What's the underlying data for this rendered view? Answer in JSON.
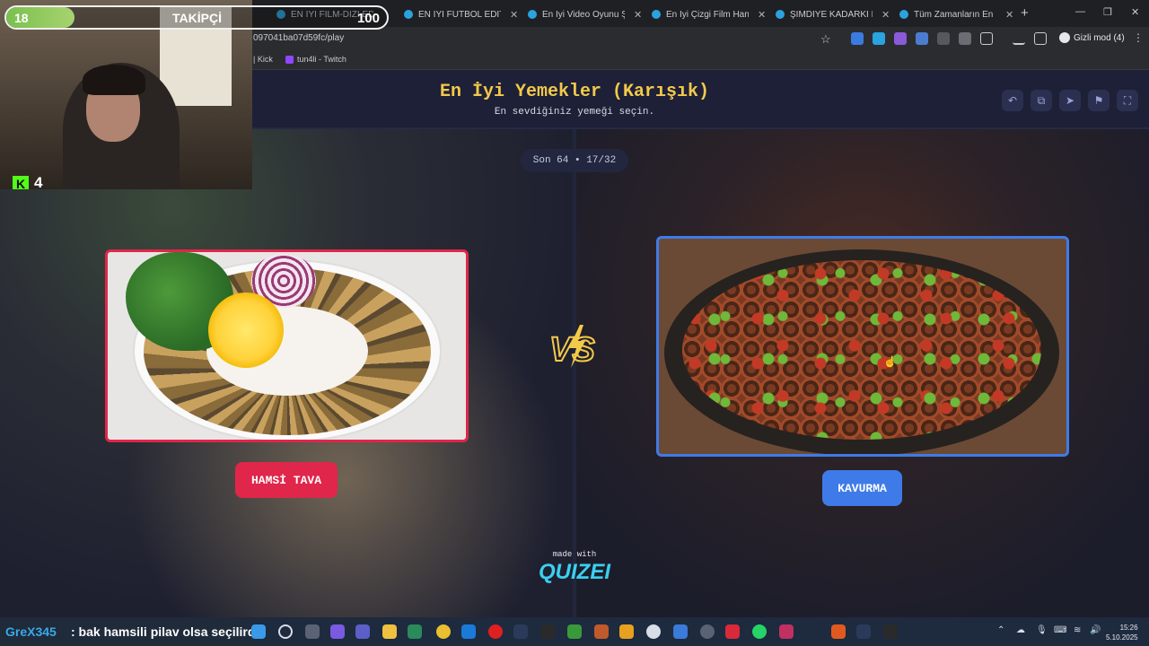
{
  "browser": {
    "tabs": [
      {
        "title": "EN İYİ FİLM-DİZİ EDİT"
      },
      {
        "title": "EN İYİ FUTBOL EDİTİ HAN"
      },
      {
        "title": "En İyi Video Oyunu Şarkısı"
      },
      {
        "title": "En İyi Çizgi Film Hangisi?"
      },
      {
        "title": "ŞİMDİYE KADARKİ EN İYİ"
      },
      {
        "title": "Tüm Zamanların En İyi Şa"
      }
    ],
    "url": "097041ba07d59fc/play",
    "incognito_label": "Gizli mod (4)",
    "bookmarks": [
      {
        "label": "| Kick"
      },
      {
        "label": "tun4li - Twitch"
      }
    ]
  },
  "quiz": {
    "title": "En İyi Yemekler (Karışık)",
    "subtitle": "En sevdiğiniz yemeği seçin.",
    "round": "Son 64 • 17/32",
    "left_option": "HAMSİ TAVA",
    "right_option": "KAVURMA",
    "vs_label": "VS",
    "made_with": "made with",
    "brand": "QUIZEI",
    "colors": {
      "left": "#e0264a",
      "right": "#3f7be8",
      "title": "#f3c94a"
    }
  },
  "overlay": {
    "follow_current": "18",
    "follow_label": "TAKİPÇİ",
    "follow_goal": "100",
    "follow_progress": 0.18,
    "kick_viewers": "4",
    "chat_user": "GreX345",
    "chat_message": ": bak hamsili pilav olsa seçilirdi"
  },
  "taskbar": {
    "time": "15:26",
    "date": "5.10.2025"
  }
}
